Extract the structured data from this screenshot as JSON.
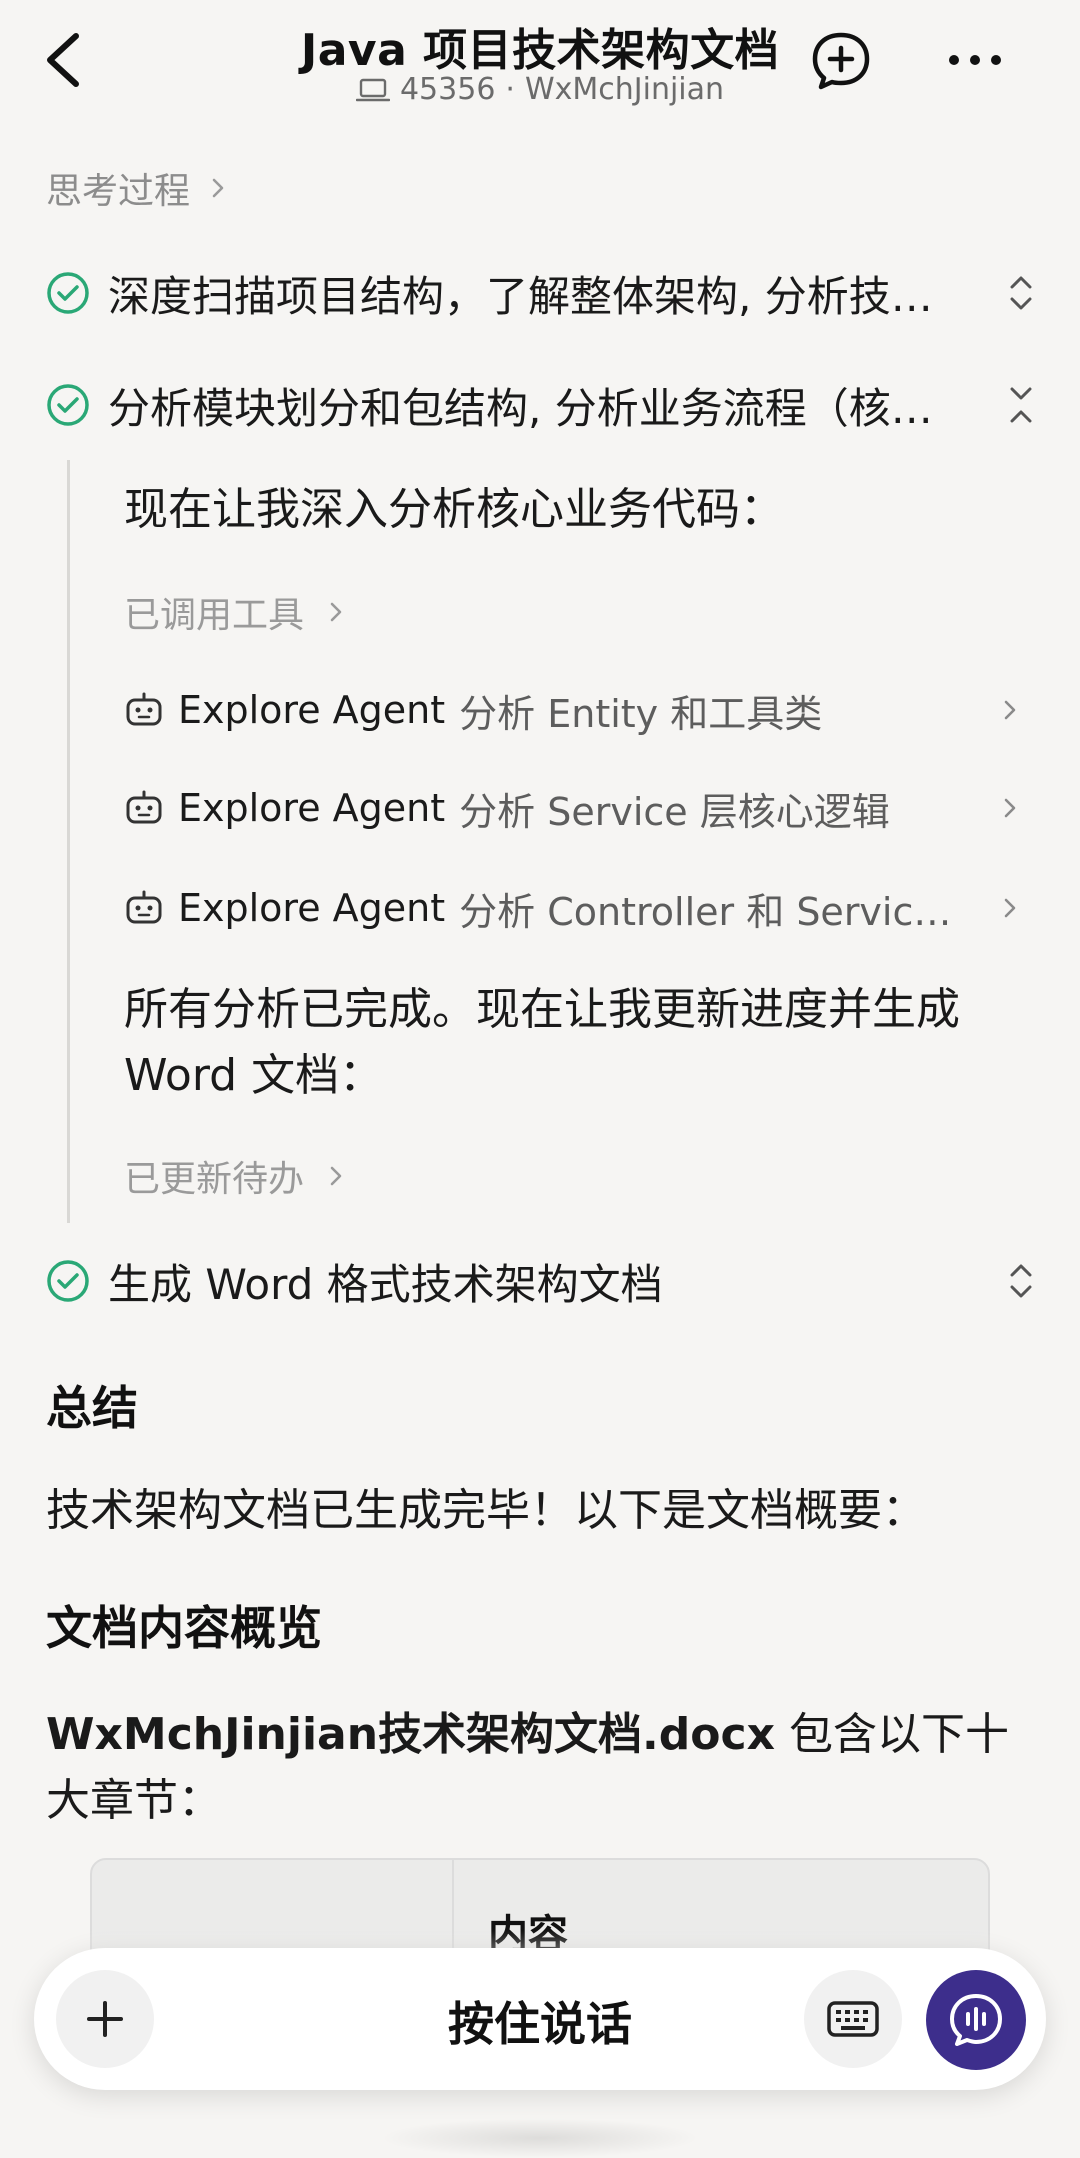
{
  "header": {
    "title": "Java 项目技术架构文档",
    "session_id": "45356",
    "separator": "·",
    "repo": "WxMchJinjian",
    "icons": {
      "back": "back-arrow-icon",
      "laptop": "laptop-icon",
      "new_chat": "new-chat-plus-icon",
      "more": "more-dots-icon"
    }
  },
  "thinking": {
    "label": "思考过程"
  },
  "steps": [
    {
      "text": "深度扫描项目结构，了解整体架构, 分析技术栈和依赖",
      "state": "collapsed"
    },
    {
      "text": "分析模块划分和包结构, 分析业务流程（核心代码）",
      "state": "expanded"
    },
    {
      "text": "生成 Word 格式技术架构文档",
      "state": "collapsed"
    }
  ],
  "expanded_detail": {
    "intro": "现在让我深入分析核心业务代码：",
    "tools_called": "已调用工具",
    "agents": [
      {
        "name": "Explore Agent",
        "task": "分析 Entity 和工具类"
      },
      {
        "name": "Explore Agent",
        "task": "分析 Service 层核心逻辑"
      },
      {
        "name": "Explore Agent",
        "task": "分析 Controller 和 Service 接口映射"
      }
    ],
    "done_line1": "所有分析已完成。现在让我更新进度并生成",
    "done_line2": "Word 文档：",
    "todo_updated": "已更新待办"
  },
  "summary": {
    "heading": "总结",
    "text": "技术架构文档已生成完毕！以下是文档概要：",
    "overview_heading": "文档内容概览",
    "file_name": "WxMchJinjian技术架构文档.docx",
    "file_desc_1": " 包含以下十",
    "file_desc_2": "大章节：",
    "table_col_content": "内容"
  },
  "input_bar": {
    "hold_to_talk": "按住说话",
    "accent_color": "#3d2e8c",
    "icons": {
      "plus": "plus-icon",
      "keyboard": "keyboard-icon",
      "voice": "voice-chat-icon"
    }
  },
  "colors": {
    "check_green": "#2aa876",
    "background": "#f6f5f3"
  }
}
